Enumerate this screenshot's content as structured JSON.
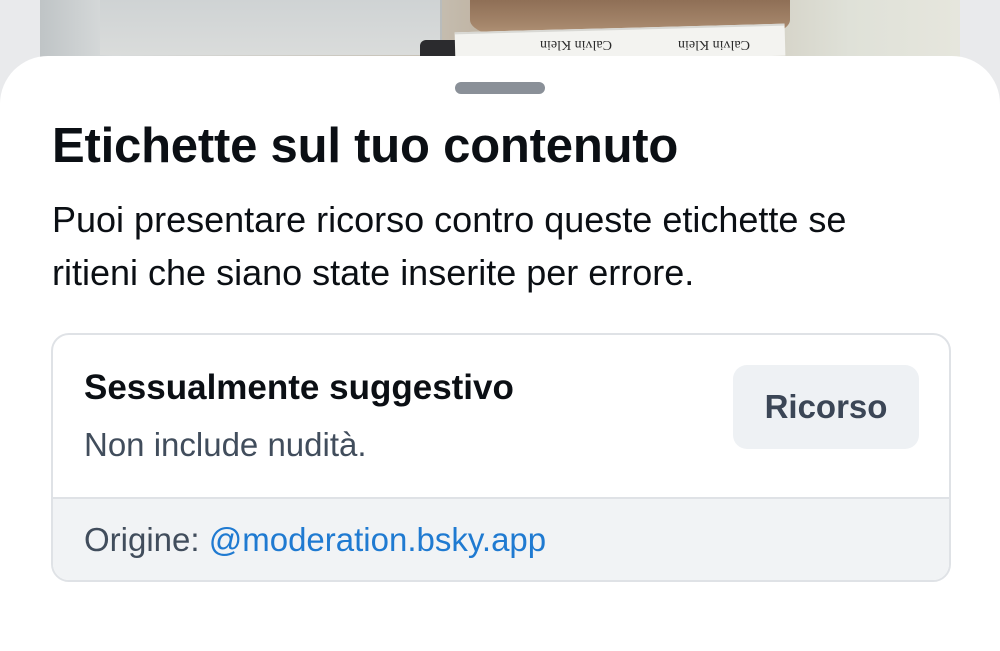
{
  "sheet": {
    "title": "Etichette sul tuo contenuto",
    "description": "Puoi presentare ricorso contro queste etichette se ritieni che siano state inserite per errore."
  },
  "label_card": {
    "name": "Sessualmente suggestivo",
    "description": "Non include nudità.",
    "appeal_button_label": "Ricorso",
    "source_prefix": "Origine:",
    "source_handle": "@moderation.bsky.app"
  },
  "background_image": {
    "brand_text_1": "Calvin Klein",
    "brand_text_2": "Calvin Klein"
  },
  "colors": {
    "link": "#1f7ad1",
    "text_primary": "#0b0f14",
    "text_secondary": "#414d5c",
    "button_bg": "#eef1f4",
    "footer_bg": "#f1f3f5",
    "border": "#dfe2e6"
  }
}
